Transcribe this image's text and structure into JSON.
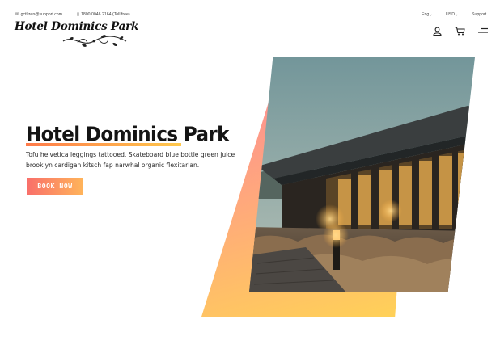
{
  "topbar": {
    "email": "gctlizen@support.com",
    "phone": "1800 0046 2164 (Toll free)",
    "language": "Eng",
    "currency": "USD",
    "support": "Support",
    "icons": [
      "mail-icon",
      "phone-icon"
    ]
  },
  "logo": {
    "text": "Hotel Dominics Park"
  },
  "header_icons": [
    "user-icon",
    "cart-icon",
    "menu-icon"
  ],
  "hero": {
    "title": "Hotel Dominics Park",
    "description": "Tofu helvetica leggings tattooed. Skateboard blue bottle green juice brooklyn cardigan kitsch fap narwhal organic flexitarian.",
    "cta_label": "BOOK NOW"
  },
  "colors": {
    "accent_start": "#f96f6a",
    "accent_end": "#ffb45a",
    "gradient_panel_top": "#fd8d94",
    "gradient_panel_bottom": "#ffd257"
  }
}
